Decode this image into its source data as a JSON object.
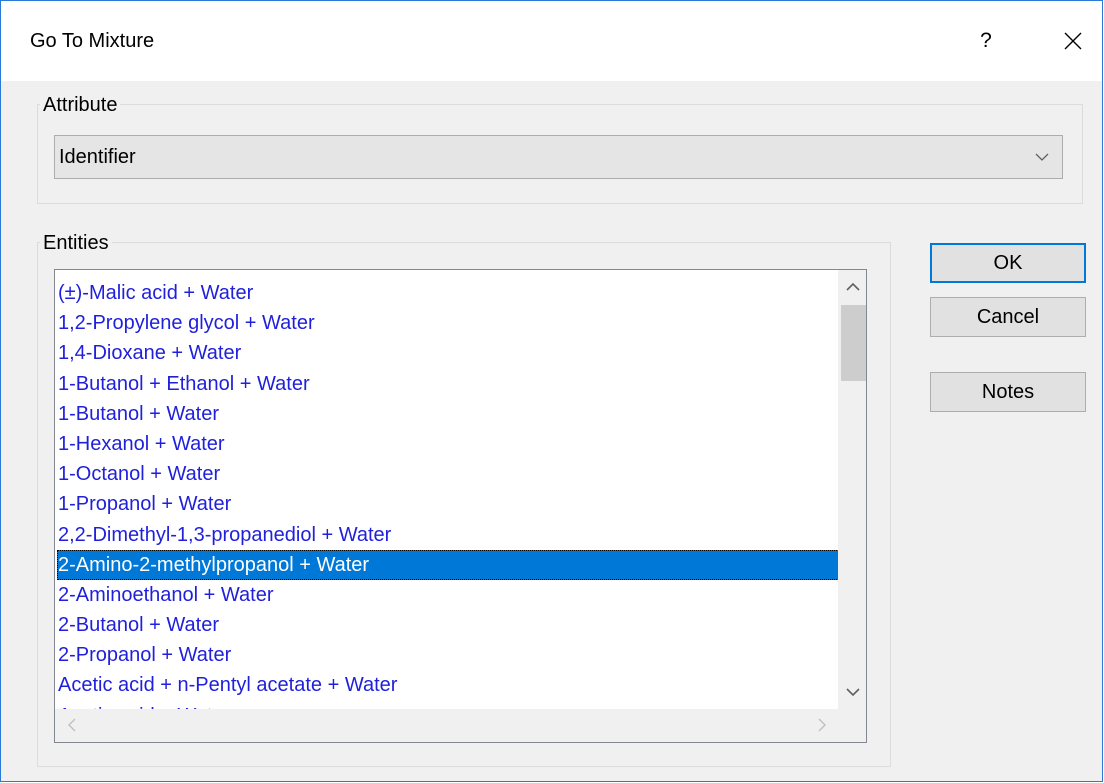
{
  "dialog": {
    "title": "Go To Mixture",
    "help_label": "?"
  },
  "attribute": {
    "group_label": "Attribute",
    "selected": "Identifier"
  },
  "entities": {
    "group_label": "Entities",
    "items": [
      "(±)-Malic acid + Water",
      "1,2-Propylene glycol + Water",
      "1,4-Dioxane + Water",
      "1-Butanol + Ethanol + Water",
      "1-Butanol + Water",
      "1-Hexanol + Water",
      "1-Octanol + Water",
      "1-Propanol + Water",
      "2,2-Dimethyl-1,3-propanediol + Water",
      "2-Amino-2-methylpropanol + Water",
      "2-Aminoethanol + Water",
      "2-Butanol + Water",
      "2-Propanol + Water",
      "Acetic acid + n-Pentyl acetate + Water",
      "Acetic acid + Water"
    ],
    "selected_index": 9
  },
  "buttons": {
    "ok": "OK",
    "cancel": "Cancel",
    "notes": "Notes"
  },
  "icons": {
    "close": "close-icon",
    "dropdown": "chevron-down-icon",
    "scroll_up": "scroll-up-arrow-icon",
    "scroll_down": "scroll-down-arrow-icon",
    "scroll_left": "scroll-left-arrow-icon",
    "scroll_right": "scroll-right-arrow-icon"
  },
  "colors": {
    "accent": "#0078d7",
    "list_text": "#1f1fdc",
    "window_border": "#2b79d7"
  }
}
